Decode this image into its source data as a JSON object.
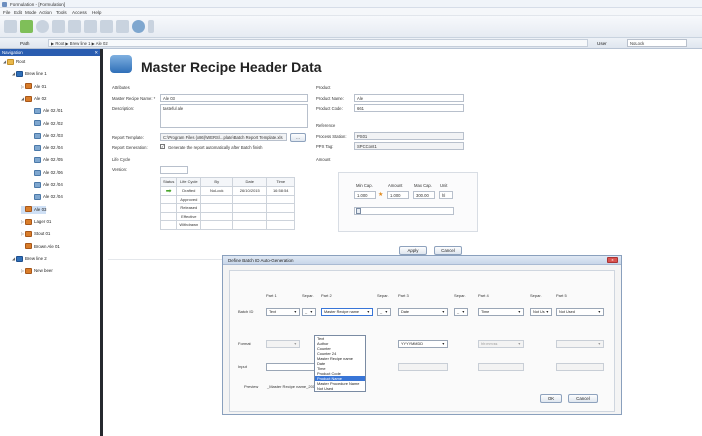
{
  "window": {
    "title": "Formulation - [Formulation]"
  },
  "menu": [
    "File",
    "Edit",
    "Mode",
    "Action",
    "Tools",
    "Access",
    "Help"
  ],
  "path": {
    "label": "Path",
    "breadcrumb": "▶ Root ▶ Brew line 1 ▶ Ale 02",
    "user_label": "User",
    "user_value": "NoLock"
  },
  "nav": {
    "header": "Navigation",
    "pin": "✕",
    "items": [
      {
        "label": "Root",
        "icon": "folder",
        "level": 0,
        "exp": "◢"
      },
      {
        "label": "Brew line 1",
        "icon": "plant",
        "level": 1,
        "exp": "◢"
      },
      {
        "label": "Ale 01",
        "icon": "ale",
        "level": 2,
        "exp": "▷"
      },
      {
        "label": "Ale 02",
        "icon": "ale",
        "level": 2,
        "exp": "◢"
      },
      {
        "label": "Ale 02 /01",
        "icon": "recipe",
        "level": 3,
        "exp": ""
      },
      {
        "label": "Ale 02 /02",
        "icon": "recipe",
        "level": 3,
        "exp": ""
      },
      {
        "label": "Ale 02 /03",
        "icon": "recipe",
        "level": 3,
        "exp": ""
      },
      {
        "label": "Ale 02 /04",
        "icon": "recipe",
        "level": 3,
        "exp": ""
      },
      {
        "label": "Ale 02 /05",
        "icon": "recipe",
        "level": 3,
        "exp": ""
      },
      {
        "label": "Ale 02 /06",
        "icon": "recipe",
        "level": 3,
        "exp": ""
      },
      {
        "label": "Ale 02 /04",
        "icon": "recipe",
        "level": 3,
        "exp": ""
      },
      {
        "label": "Ale 02 /04",
        "icon": "recipe",
        "level": 3,
        "exp": ""
      },
      {
        "label": "Ale 03",
        "icon": "ale",
        "level": 2,
        "exp": "",
        "selected": true
      },
      {
        "label": "Lager 01",
        "icon": "ale",
        "level": 2,
        "exp": "▷"
      },
      {
        "label": "Stout 01",
        "icon": "ale",
        "level": 2,
        "exp": "▷"
      },
      {
        "label": "Brown Ale 01",
        "icon": "ale",
        "level": 2,
        "exp": ""
      },
      {
        "label": "Brew line 2",
        "icon": "plant",
        "level": 1,
        "exp": "◢"
      },
      {
        "label": "New beer",
        "icon": "ale",
        "level": 2,
        "exp": "▷"
      }
    ]
  },
  "header": {
    "title": "Master Recipe Header Data"
  },
  "attributes": {
    "section": "Attributes",
    "name_label": "Master Recipe Name: *",
    "name_value": "Ale 03",
    "desc_label": "Description:",
    "desc_value": "tasteful ale",
    "template_label": "Report Template:",
    "template_value": "C:\\Program Files (x86)\\WERS\\...plate\\Batch Report Template.xls",
    "browse": "...",
    "generation_label": "Report Generation:",
    "generation_text": "Generate the report automatically after Batch finish"
  },
  "product": {
    "section": "Product",
    "name_label": "Product Name:",
    "name_value": "Ale",
    "code_label": "Product Code:",
    "code_value": "661"
  },
  "reference": {
    "section": "Reference",
    "station_label": "Process Station:",
    "station_value": "PS01",
    "ppx_label": "PPX Tag:",
    "ppx_value": "SPCCont1"
  },
  "lifecycle": {
    "section": "Life Cycle",
    "version_label": "Version:",
    "headers": [
      "Status",
      "Life Cycle",
      "By",
      "Date",
      "Time"
    ],
    "rows": [
      [
        "Drafted",
        "NoLock",
        "26/10/2015",
        "16:58:54"
      ],
      [
        "Approved",
        "",
        "",
        ""
      ],
      [
        "Released",
        "",
        "",
        ""
      ],
      [
        "Effective",
        "",
        "",
        ""
      ],
      [
        "Withdrawn",
        "",
        "",
        ""
      ]
    ]
  },
  "amount": {
    "section": "Amount",
    "headers": [
      "Min Cap.",
      "Amount",
      "Max Cap.",
      "Unit"
    ],
    "values": [
      "1.000",
      "1.000",
      "300.00",
      "hl"
    ]
  },
  "buttons": {
    "apply": "Apply",
    "cancel": "Cancel"
  },
  "dialog": {
    "title": "Define Batch ID Auto-Generation",
    "close": "x",
    "part_headers": [
      "Part 1",
      "Separ.",
      "Part 2",
      "Separ.",
      "Part 3",
      "Separ.",
      "Part 4",
      "Separ.",
      "Part 5"
    ],
    "row_batch": "Batch ID",
    "row_format": "Format",
    "row_input": "Input",
    "batch_values": [
      "Text",
      "_",
      "Master Recipe name",
      "_",
      "Date",
      "_",
      "Time",
      "Not Us",
      "Not Used"
    ],
    "format_values": [
      "YYYYMMDD",
      "hh:mm:ss"
    ],
    "dropdown": [
      "Text",
      "Author",
      "Counter",
      "Counter 24",
      "Master Recipe name",
      "Date",
      "Time",
      "Product Code",
      "Product Name",
      "Master Procedure Name",
      "Not Used"
    ],
    "dropdown_selected": "Product Name",
    "preview_label": "Preview",
    "preview_value": "_Master Recipe name_2015-10-27_09:59:12",
    "ok": "OK",
    "cancel": "Cancel"
  },
  "colors": {
    "nav_header": "#2a5db0",
    "accent": "#3875d7",
    "arrow": "#49a52c"
  }
}
